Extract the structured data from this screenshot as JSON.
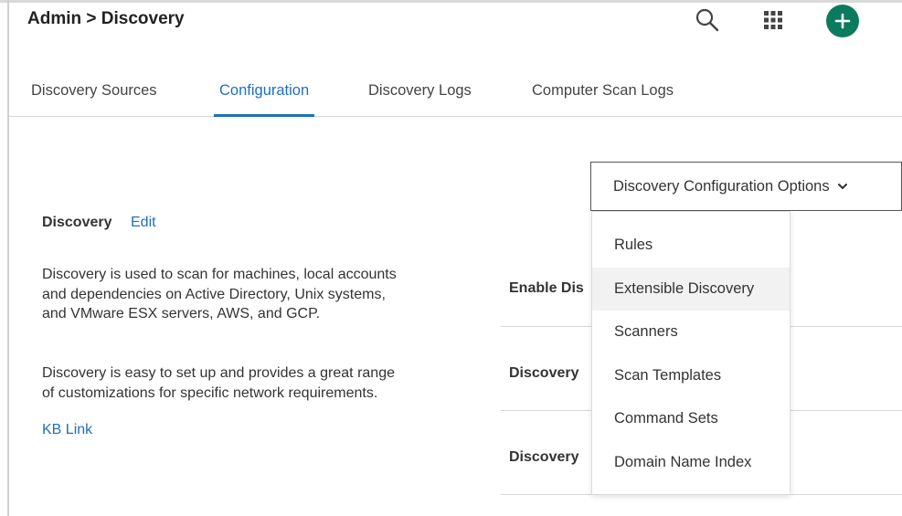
{
  "header": {
    "title": "Admin > Discovery",
    "icons": [
      "search-icon",
      "apps-grid-icon",
      "add-icon"
    ],
    "add_button_color": "#0a7b5c"
  },
  "tabs": [
    {
      "label": "Discovery Sources",
      "active": false
    },
    {
      "label": "Configuration",
      "active": true
    },
    {
      "label": "Discovery Logs",
      "active": false
    },
    {
      "label": "Computer Scan Logs",
      "active": false
    }
  ],
  "accent_color": "#1f6fbf",
  "info": {
    "title": "Discovery",
    "edit_label": "Edit",
    "paragraph1": "Discovery is used to scan for machines, local accounts and dependencies on Active Directory, Unix systems, and VMware ESX servers, AWS, and GCP.",
    "paragraph2": "Discovery is easy to set up and provides a great range of customizations for specific network requirements.",
    "kb_link": "KB Link"
  },
  "settings_rows": [
    {
      "label": "Enable Dis"
    },
    {
      "label": "Discovery"
    },
    {
      "label": "Discovery"
    }
  ],
  "options_dropdown": {
    "label": "Discovery Configuration Options",
    "expanded": true,
    "items": [
      {
        "label": "Rules"
      },
      {
        "label": "Extensible Discovery",
        "hovered": true
      },
      {
        "label": "Scanners"
      },
      {
        "label": "Scan Templates"
      },
      {
        "label": "Command Sets"
      },
      {
        "label": "Domain Name Index"
      }
    ]
  }
}
